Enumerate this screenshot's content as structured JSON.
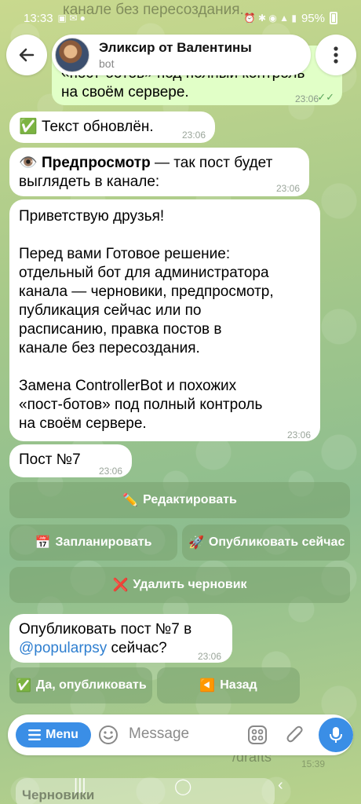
{
  "status_bar": {
    "time": "13:33",
    "battery": "95%"
  },
  "header": {
    "title": "Эликсир от Валентины",
    "subtitle": "bot"
  },
  "top_partial": {
    "ghost_line": "канале без пересоздания.",
    "line1": "«пост-ботов» под полный контроль",
    "line2": "на своём сервере.",
    "time": "23:06",
    "checks": "✓✓"
  },
  "messages": [
    {
      "emoji": "✅",
      "text": "Текст обновлён.",
      "time": "23:06"
    },
    {
      "emoji": "👁️",
      "bold": "Предпросмотр",
      "text": " — так пост будет выглядеть в канале:",
      "time": "23:06"
    },
    {
      "lines": [
        "Приветствую друзья!",
        "",
        "Перед вами Готовое решение:",
        "отдельный бот для администратора",
        "канала — черновики, предпросмотр,",
        "публикация сейчас или по",
        "расписанию, правка постов в",
        "канале без пересоздания.",
        "",
        "Замена ControllerBot и похожих",
        "«пост-ботов» под полный контроль",
        "на своём сервере."
      ],
      "time": "23:06"
    },
    {
      "text": "Пост №7",
      "time": "23:06"
    },
    {
      "text_before": "Опубликовать пост №7 в",
      "link": "@popularpsy",
      "text_after": " сейчас?",
      "time": "23:06"
    }
  ],
  "keyboard1": [
    {
      "emoji": "✏️",
      "label": "Редактировать"
    },
    {
      "emoji": "📅",
      "label": "Запланировать"
    },
    {
      "emoji": "🚀",
      "label": "Опубликовать сейчас"
    },
    {
      "emoji": "❌",
      "label": "Удалить черновик"
    }
  ],
  "keyboard2": [
    {
      "emoji": "✅",
      "label": "Да, опубликовать"
    },
    {
      "emoji": "◀️",
      "label": "Назад"
    }
  ],
  "input": {
    "menu_label": "Menu",
    "placeholder": "Message"
  },
  "bottom_ghost": {
    "drafts": "/drafts",
    "time": "15:39",
    "chernoviki": "Черновики"
  },
  "colors": {
    "accent": "#3a8ee6",
    "bubble_in": "#ffffff",
    "bubble_out": "#e1ffc7",
    "button": "#78a06e"
  }
}
